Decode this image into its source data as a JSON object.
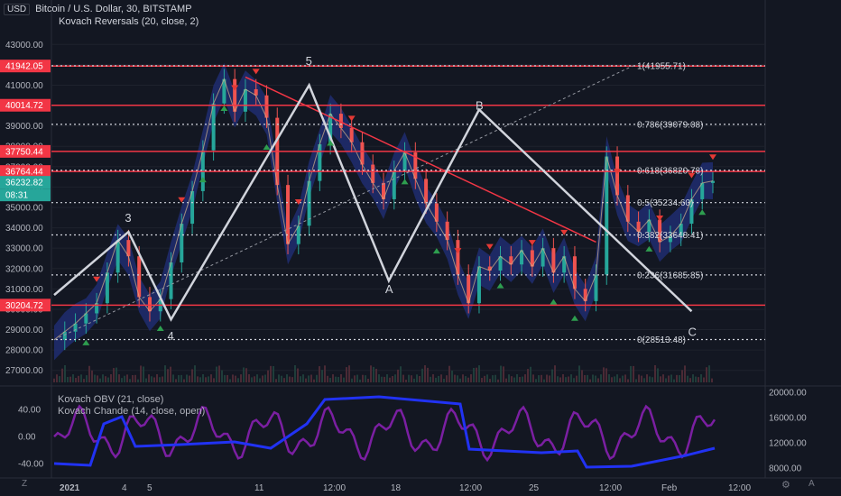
{
  "header": {
    "currency": "USD",
    "symbol_line": "Bitcoin / U.S. Dollar, 30, BITSTAMP",
    "indicator_line": "Kovach Reversals (20, close, 2)"
  },
  "lower_panel": {
    "line1": "Kovach OBV (21, close)",
    "line2": "Kovach Chande (14, close, open)",
    "left_ticks": [
      "40.00",
      "0.00",
      "-40.00"
    ],
    "right_ticks": [
      "20000.00",
      "16000.00",
      "12000.00",
      "8000.00"
    ]
  },
  "footer": {
    "left_icon": "tradingview-logo-icon",
    "right_icon": "auto-scale-icon",
    "settings_icon": "gear-icon",
    "left_glyph": "Z",
    "right_glyph": "A",
    "settings_glyph": "⚙"
  },
  "chart_data": {
    "type": "line",
    "title": "Bitcoin / U.S. Dollar, 30, BITSTAMP",
    "x_ticks": [
      "2021",
      "4",
      "5",
      "11",
      "12:00",
      "18",
      "12:00",
      "25",
      "12:00",
      "Feb",
      "12:00"
    ],
    "y_ticks": [
      "43000.00",
      "42000.00",
      "41000.00",
      "40000.00",
      "39000.00",
      "38000.00",
      "37000.00",
      "36000.00",
      "35000.00",
      "34000.00",
      "33000.00",
      "32000.00",
      "31000.00",
      "30000.00",
      "29000.00",
      "28000.00",
      "27000.00"
    ],
    "ylim": [
      26500,
      43500
    ],
    "price_labels": [
      {
        "value": 41942.05,
        "text": "41942.05",
        "color": "#f23645"
      },
      {
        "value": 40014.72,
        "text": "40014.72",
        "color": "#f23645"
      },
      {
        "value": 37750.44,
        "text": "37750.44",
        "color": "#f23645"
      },
      {
        "value": 36764.44,
        "text": "36764.44",
        "color": "#f23645"
      },
      {
        "value": 36232.82,
        "text": "36232.82",
        "color": "#26a69a"
      },
      {
        "value": 30204.72,
        "text": "30204.72",
        "color": "#f23645"
      }
    ],
    "countdown_label": "08:31",
    "resistance_lines": [
      41942.05,
      40014.72,
      37750.44,
      36764.44,
      30204.72
    ],
    "fib_levels": [
      {
        "value": 41955.71,
        "text": "1(41955.71)"
      },
      {
        "value": 39079.08,
        "text": "0.786(39079.08)"
      },
      {
        "value": 36820.78,
        "text": "0.618(36820.78)"
      },
      {
        "value": 35234.6,
        "text": "0.5(35234.60)"
      },
      {
        "value": 33648.41,
        "text": "0.382(33648.41)"
      },
      {
        "value": 31685.85,
        "text": "0.236(31685.85)"
      },
      {
        "value": 28513.48,
        "text": "0(28513.48)"
      }
    ],
    "price_series": [
      28500,
      28900,
      29300,
      29800,
      30300,
      31800,
      33400,
      32600,
      30600,
      29900,
      30500,
      32300,
      34200,
      35800,
      37800,
      40100,
      41300,
      39700,
      40800,
      40500,
      39400,
      36100,
      33200,
      34100,
      36300,
      38100,
      39600,
      38900,
      38200,
      37100,
      36200,
      35400,
      36800,
      37700,
      36400,
      35200,
      34300,
      33400,
      31700,
      30300,
      32100,
      31900,
      32600,
      32200,
      32900,
      32100,
      33000,
      31800,
      32600,
      31000,
      30400,
      31700,
      37500,
      35600,
      34300,
      33800,
      34400,
      33300,
      33600,
      34200,
      35400,
      36200,
      36300
    ],
    "wave_labels": [
      {
        "text": "3",
        "t": 7,
        "value": 34300
      },
      {
        "text": "4",
        "t": 11,
        "value": 28500
      },
      {
        "text": "5",
        "t": 24,
        "value": 42000
      },
      {
        "text": "A",
        "t": 31.5,
        "value": 30800
      },
      {
        "text": "B",
        "t": 40,
        "value": 39800
      },
      {
        "text": "C",
        "t": 60,
        "value": 28700
      }
    ]
  }
}
